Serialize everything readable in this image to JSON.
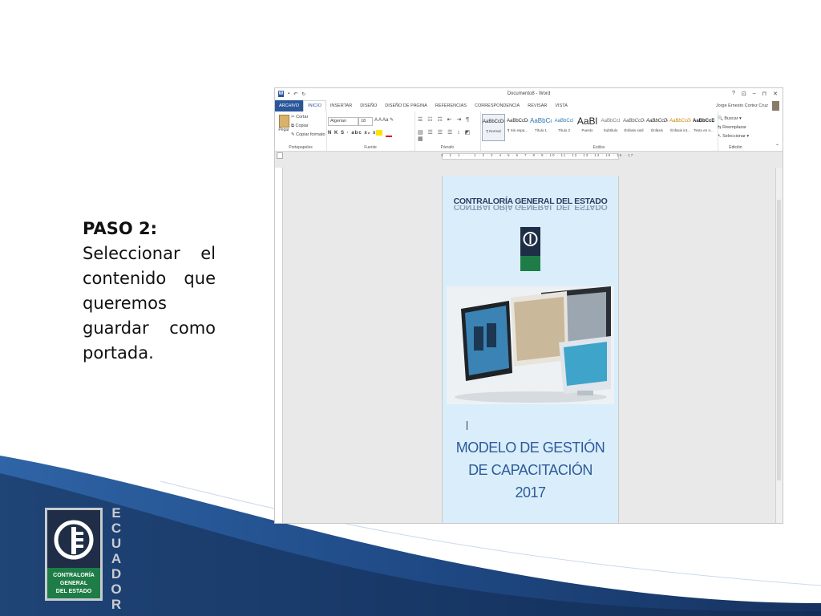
{
  "slide": {
    "step_title": "PASO 2:",
    "step_text": "Seleccionar el contenido que queremos guardar como portada.",
    "logo_text_lines": [
      "CONTRALORÍA",
      "GENERAL",
      "DEL ESTADO"
    ],
    "logo_side_letters": [
      "E",
      "C",
      "U",
      "A",
      "D",
      "O",
      "R"
    ],
    "colors": {
      "wave_dark": "#1c3a6b",
      "wave_light": "#3b6fb0",
      "logo_green": "#1e7d46"
    }
  },
  "word": {
    "document_title": "Documento8 - Word",
    "window_controls": [
      "?",
      "⊡",
      "–",
      "⊓",
      "✕"
    ],
    "tabs": [
      "ARCHIVO",
      "INICIO",
      "INSERTAR",
      "DISEÑO",
      "DISEÑO DE PÁGINA",
      "REFERENCIAS",
      "CORRESPONDENCIA",
      "REVISAR",
      "VISTA"
    ],
    "active_tab": "INICIO",
    "user_name": "Jorge Ernesto Cortez Cruz",
    "clipboard": {
      "paste": "Pegar",
      "cut": "Cortar",
      "copy": "Copiar",
      "format_painter": "Copiar formato",
      "label": "Portapapeles"
    },
    "font": {
      "name": "Algerian",
      "size": "18",
      "label": "Fuente",
      "format_row": "N K S · abc x₂ x²"
    },
    "paragraph": {
      "label": "Párrafo"
    },
    "styles": {
      "label": "Estilos",
      "items": [
        {
          "preview": "AaBbCcDc",
          "name": "¶ Normal"
        },
        {
          "preview": "AaBbCcDc",
          "name": "¶ Sin espa..."
        },
        {
          "preview": "AaBbCc",
          "name": "Título 1"
        },
        {
          "preview": "AaBbCcI",
          "name": "Título 2"
        },
        {
          "preview": "AaBl",
          "name": "Puesto"
        },
        {
          "preview": "AaBbCcI",
          "name": "Subtítulo"
        },
        {
          "preview": "AaBbCcDc",
          "name": "Énfasis sutil"
        },
        {
          "preview": "AaBbCcDc",
          "name": "Énfasis"
        },
        {
          "preview": "AaBbCcDc",
          "name": "Énfasis int..."
        },
        {
          "preview": "AaBbCcDc",
          "name": "Texto en n..."
        }
      ]
    },
    "editing": {
      "find": "Buscar",
      "replace": "Reemplazar",
      "select": "Seleccionar",
      "label": "Edición"
    },
    "ruler_numbers": "3 · 2 · 1 · · · 1 · 2 · 3 · 4 · 5 · 6 · 7 · 8 · 9 · 10 · 11 · 12 · 13 · 14 · 15 · 16 · 17",
    "page": {
      "header": "CONTRALORÍA GENERAL DEL ESTADO",
      "title_lines": [
        "MODELO DE GESTIÓN",
        "DE CAPACITACIÓN",
        "2017"
      ]
    }
  }
}
